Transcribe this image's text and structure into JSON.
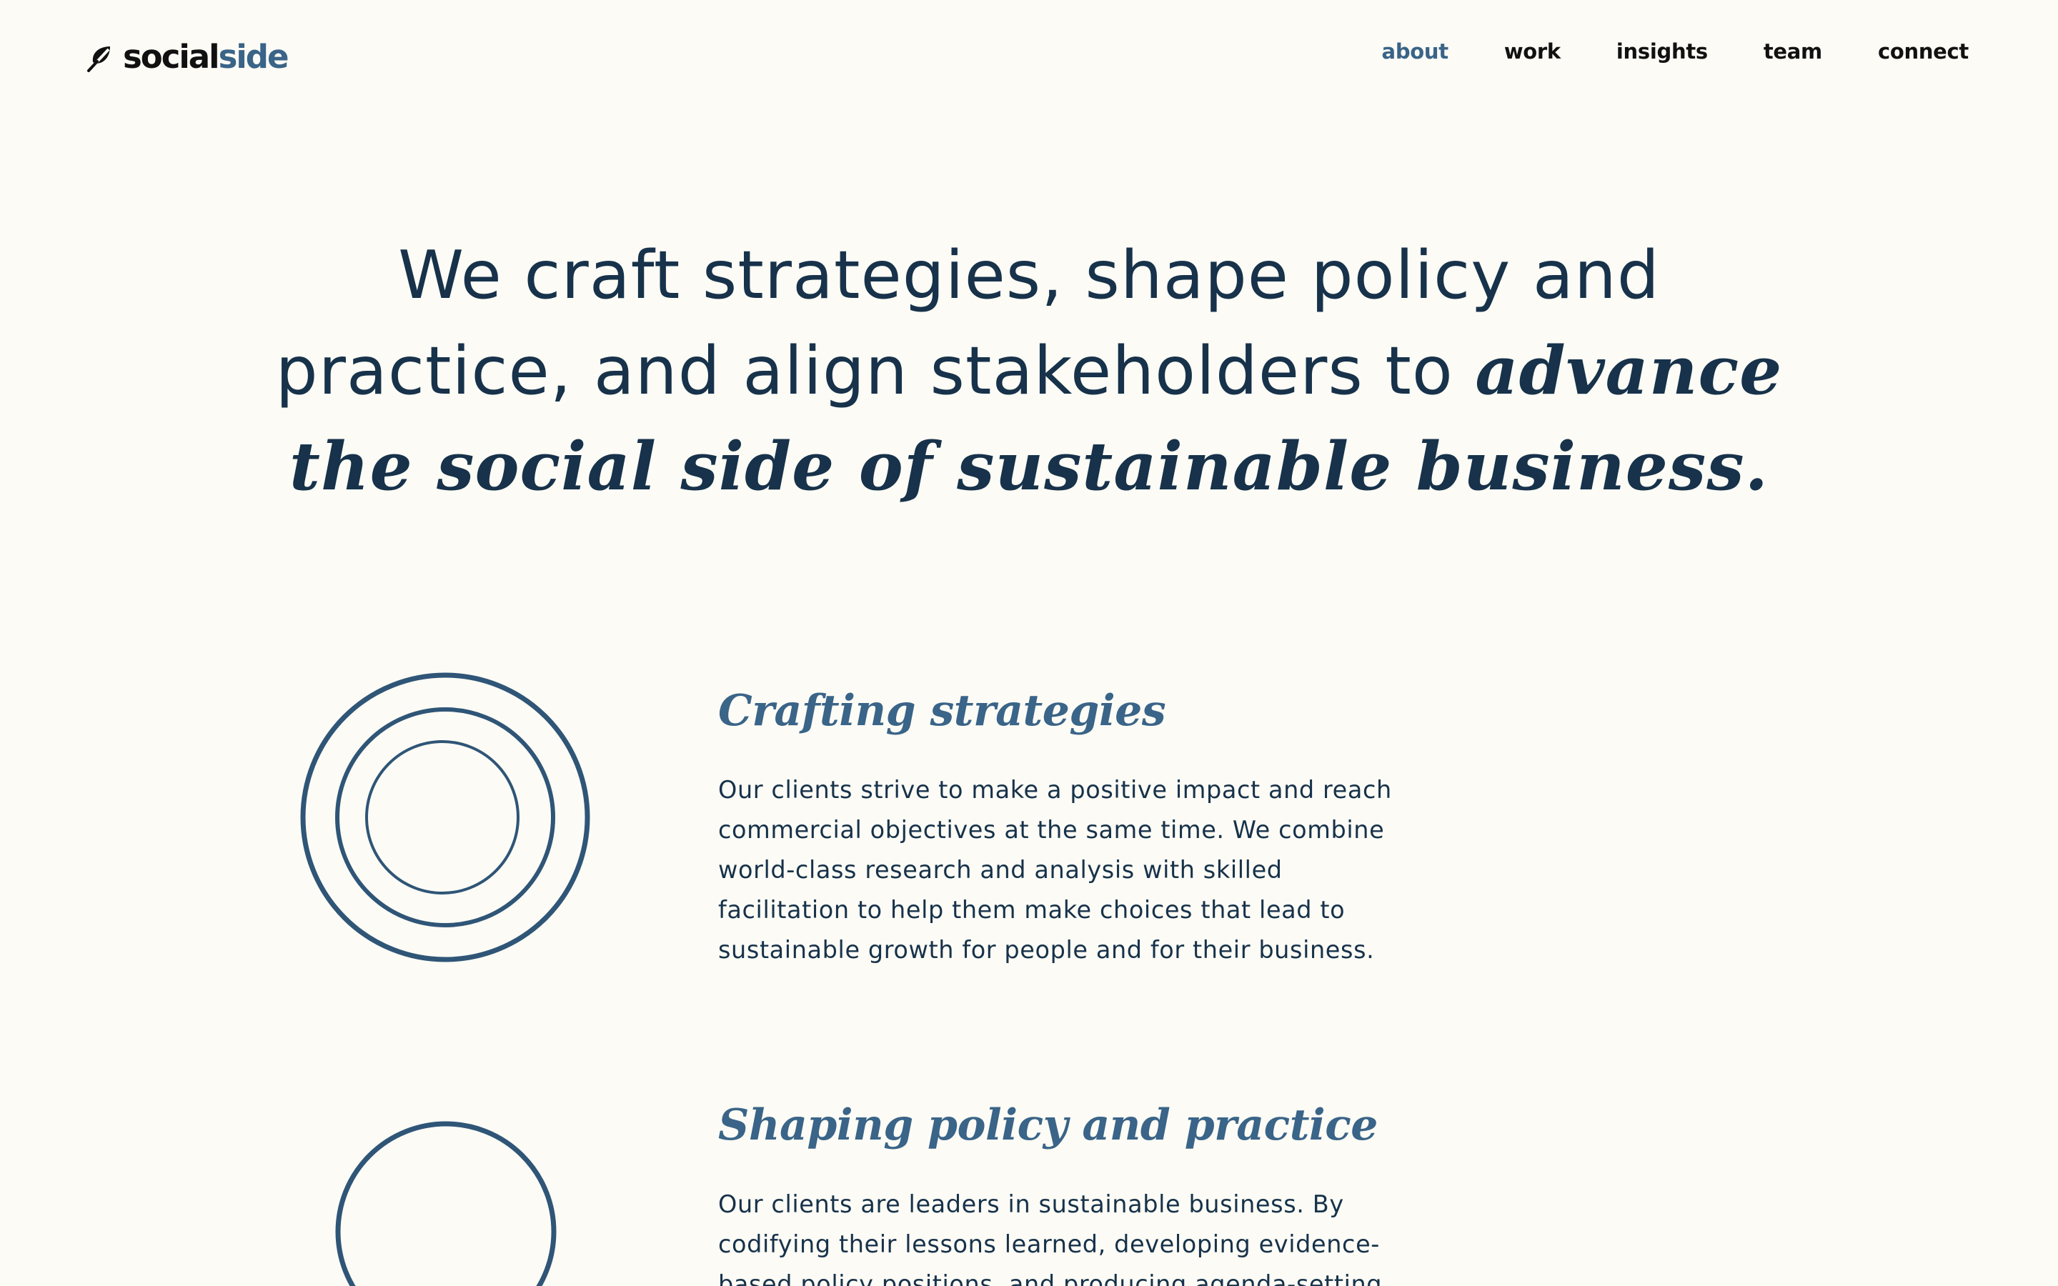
{
  "brand": {
    "name_main": "social",
    "name_accent": "side",
    "logo_icon": "leaf-slash-icon",
    "colors": {
      "background": "#fcfbf5",
      "text": "#17324a",
      "accent": "#3a6488"
    }
  },
  "nav": {
    "items": [
      {
        "label": "about",
        "active": true
      },
      {
        "label": "work",
        "active": false
      },
      {
        "label": "insights",
        "active": false
      },
      {
        "label": "team",
        "active": false
      },
      {
        "label": "connect",
        "active": false
      }
    ]
  },
  "hero": {
    "lead": "We craft strategies, shape policy and practice, and align stakeholders to ",
    "emphasis": "advance the social side of sustainable business."
  },
  "sections": [
    {
      "icon": "concentric-circles-icon",
      "title": "Crafting strategies",
      "body": "Our clients strive to make a positive impact and reach commercial objectives at the same time. We combine world-class research and analysis with skilled facilitation to help them make choices that lead to sustainable growth for people and for their business."
    },
    {
      "icon": "circle-icon",
      "title": "Shaping policy and practice",
      "body": "Our clients are leaders in sustainable business. By codifying their lessons learned, developing evidence-based policy positions, and producing agenda-setting"
    }
  ]
}
